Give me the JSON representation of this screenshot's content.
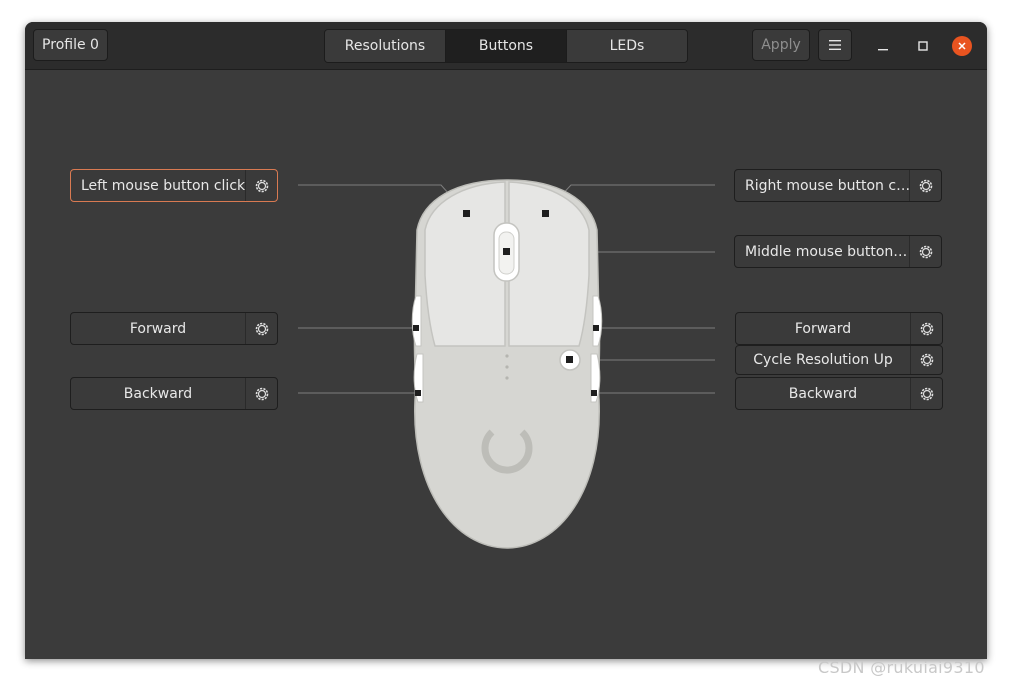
{
  "header": {
    "profile_label": "Profile 0",
    "tabs": [
      {
        "label": "Resolutions",
        "active": false
      },
      {
        "label": "Buttons",
        "active": true
      },
      {
        "label": "LEDs",
        "active": false
      }
    ],
    "apply_label": "Apply",
    "menu_icon": "hamburger-icon",
    "window_controls": [
      "minimize-icon",
      "maximize-icon",
      "close-icon"
    ]
  },
  "buttons": {
    "left_click": "Left mouse button click",
    "right_click": "Right mouse button c…",
    "middle_click": "Middle mouse button…",
    "left_forward": "Forward",
    "left_backward": "Backward",
    "right_forward": "Forward",
    "right_cycle": "Cycle Resolution Up",
    "right_backward": "Backward"
  },
  "colors": {
    "focus_border": "#d97a52",
    "close_button": "#e95420",
    "mouse_body": "#d6d6d2",
    "mouse_buttons": "#e6e6e4"
  },
  "watermark": "CSDN @rukuiai9310"
}
